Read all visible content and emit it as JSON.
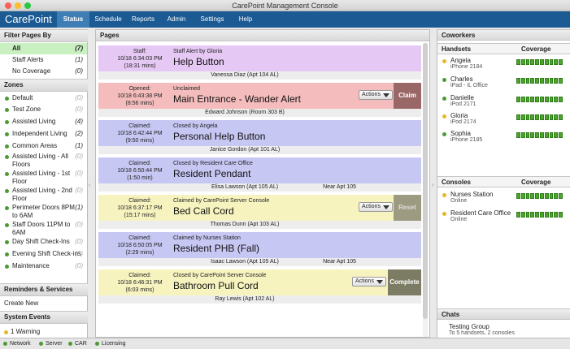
{
  "window_title": "CarePoint Management Console",
  "brand": "CarePoint",
  "nav": [
    "Status",
    "Schedule",
    "Reports",
    "Admin",
    "Settings",
    "Help"
  ],
  "left": {
    "filter_title": "Filter Pages By",
    "filters": [
      {
        "label": "All",
        "count": "(7)"
      },
      {
        "label": "Staff Alerts",
        "count": "(1)"
      },
      {
        "label": "No Coverage",
        "count": "(0)"
      }
    ],
    "zones_title": "Zones",
    "zones": [
      {
        "label": "Default",
        "count": "(0)"
      },
      {
        "label": "Test Zone",
        "count": "(0)"
      },
      {
        "label": "Assisted Living",
        "count": "(4)"
      },
      {
        "label": "Independent Living",
        "count": "(2)"
      },
      {
        "label": "Common Areas",
        "count": "(1)"
      },
      {
        "label": "Assisted Living - All Floors",
        "count": "(0)"
      },
      {
        "label": "Assisted Living - 1st Floor",
        "count": "(0)"
      },
      {
        "label": "Assisted Living - 2nd Floor",
        "count": "(0)"
      },
      {
        "label": "Perimeter Doors 8PM to 6AM",
        "count": "(1)"
      },
      {
        "label": "Staff Doors 11PM to 6AM",
        "count": "(0)"
      },
      {
        "label": "Day Shift  Check-Ins",
        "count": "(0)"
      },
      {
        "label": "Evening Shift Check-ins",
        "count": "(0)"
      },
      {
        "label": "Maintenance",
        "count": "(0)"
      }
    ],
    "reminders_title": "Reminders & Services",
    "create_new": "Create New",
    "system_events_title": "System Events",
    "warning": "1 Warning"
  },
  "center": {
    "title": "Pages",
    "pages": [
      {
        "status": "Staff:",
        "date": "10/18 6:34:03 PM",
        "elapsed": "(18:31 mins)",
        "sub": "Staff Alert by Gloria",
        "name": "Help Button",
        "who": "Vanessa Diaz (Apt 104 AL)",
        "near": "",
        "actions": "",
        "button": "",
        "color": "#e6c8f4"
      },
      {
        "status": "Opened:",
        "date": "10/18 6:43:38 PM",
        "elapsed": "(8:56 mins)",
        "sub": "Unclaimed",
        "name": "Main Entrance  - Wander Alert",
        "who": "Edward Johnson (Room 303 B)",
        "near": "",
        "actions": "Actions",
        "button": "Claim",
        "color": "#f4bcbc",
        "button_color": "#9a6767"
      },
      {
        "status": "Claimed:",
        "date": "10/18 6:42:44 PM",
        "elapsed": "(9:50 mins)",
        "sub": "Closed by Angela",
        "name": "Personal Help Button",
        "who": "Janice Gordon (Apt 101 AL)",
        "near": "",
        "actions": "",
        "button": "",
        "color": "#c7c7f4"
      },
      {
        "status": "Claimed:",
        "date": "10/18 6:50:44 PM",
        "elapsed": "(1:50 min)",
        "sub": "Closed by Resident Care Office",
        "name": "Resident Pendant",
        "who": "Elisa Lawson (Apt 105 AL)",
        "near": "Near Apt 105",
        "actions": "",
        "button": "",
        "color": "#c7c7f4"
      },
      {
        "status": "Claimed:",
        "date": "10/18 6:37:17 PM",
        "elapsed": "(15:17 mins)",
        "sub": "Claimed by CarePoint Server Console",
        "name": "Bed Call Cord",
        "who": "Thomas Dunn (Apt 103 AL)",
        "near": "",
        "actions": "Actions",
        "button": "Reset",
        "color": "#f6f3bf",
        "button_color": "#9c9a80"
      },
      {
        "status": "Claimed:",
        "date": "10/18 6:50:05 PM",
        "elapsed": "(2:29 mins)",
        "sub": "Claimed by Nurses Station",
        "name": "Resident PHB (Fall)",
        "who": "Isaac Lawson (Apt 105 AL)",
        "near": "Near Apt 105",
        "actions": "",
        "button": "",
        "color": "#c7c7f4"
      },
      {
        "status": "Claimed:",
        "date": "10/18 6:46:31 PM",
        "elapsed": "(6:03 mins)",
        "sub": "Closed by CarePoint Server Console",
        "name": "Bathroom Pull Cord",
        "who": "Ray  Lewis (Apt 102 AL)",
        "near": "",
        "actions": "Actions",
        "button": "Complete",
        "color": "#f6f3bf",
        "button_color": "#7c7c64"
      }
    ]
  },
  "right": {
    "coworkers_title": "Coworkers",
    "handsets_label": "Handsets",
    "coverage_label": "Coverage",
    "handsets": [
      {
        "name": "Angela",
        "device": "iPhone 2184",
        "dot": "#e8b62a"
      },
      {
        "name": "Charles",
        "device": "iPad - IL Office",
        "dot": "#4c9a35"
      },
      {
        "name": "Danielle",
        "device": "iPod 2171",
        "dot": "#4c9a35"
      },
      {
        "name": "Gloria",
        "device": "iPod 2174",
        "dot": "#e8b62a"
      },
      {
        "name": "Sophia",
        "device": "iPhone 2185",
        "dot": "#4c9a35"
      }
    ],
    "consoles_label": "Consoles",
    "consoles": [
      {
        "name": "Nurses Station",
        "device": "Online",
        "dot": "#e8b62a"
      },
      {
        "name": "Resident Care Office",
        "device": "Online",
        "dot": "#e8b62a"
      }
    ],
    "chats_title": "Chats",
    "chat": {
      "name": "Testing Group",
      "desc": "To 5 handsets, 2 consoles"
    }
  },
  "status_bar": [
    "Network",
    "Server",
    "CAR",
    "Licensing"
  ]
}
